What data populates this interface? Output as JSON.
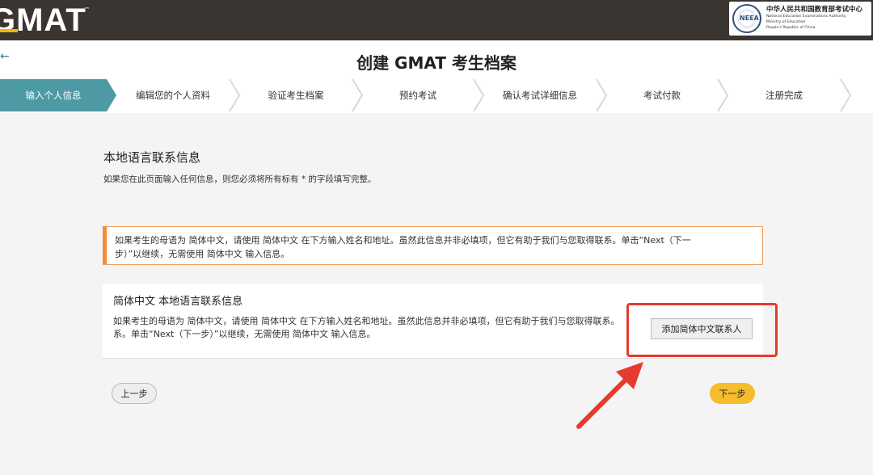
{
  "brand": {
    "logo_text": "GMAT",
    "tm": "™",
    "authority_cn": "中华人民共和国教育部考试中心",
    "authority_en": [
      "National Education Examinations Authority",
      "Ministry of Education",
      "People's Republic of China"
    ],
    "seal_text": "NEEA"
  },
  "header": {
    "back_icon": "←",
    "title": "创建 GMAT 考生档案"
  },
  "steps": [
    {
      "label": "输入个人信息",
      "active": true
    },
    {
      "label": "编辑您的个人资料",
      "active": false
    },
    {
      "label": "验证考生档案",
      "active": false
    },
    {
      "label": "预约考试",
      "active": false
    },
    {
      "label": "确认考试详细信息",
      "active": false
    },
    {
      "label": "考试付款",
      "active": false
    },
    {
      "label": "注册完成",
      "active": false
    }
  ],
  "section": {
    "title": "本地语言联系信息",
    "note": "如果您在此页面输入任何信息，则您必须将所有标有 * 的字段填写完整。"
  },
  "alert": {
    "line1": "如果考生的母语为 简体中文，请使用 简体中文 在下方输入姓名和地址。虽然此信息并非必填项，但它有助于我们与您取得联系。单击“Next（下一",
    "line2": "步）”以继续，无需使用 简体中文 输入信息。"
  },
  "card": {
    "title": "简体中文 本地语言联系信息",
    "body_line1": "如果考生的母语为 简体中文，请使用 简体中文 在下方输入姓名和地址。虽然此信息并非必填项，但它有助于我们与您取得联系。",
    "body_line2": "系。单击“Next（下一步）”以继续，无需使用 简体中文 输入信息。",
    "add_button": "添加简体中文联系人"
  },
  "nav": {
    "prev": "上一步",
    "next": "下一步"
  },
  "colors": {
    "topbar": "#3b3532",
    "accent_teal": "#4d9aa5",
    "alert_orange": "#f08c3a",
    "next_yellow": "#f5bd2c",
    "annotation_red": "#e53a2f"
  }
}
